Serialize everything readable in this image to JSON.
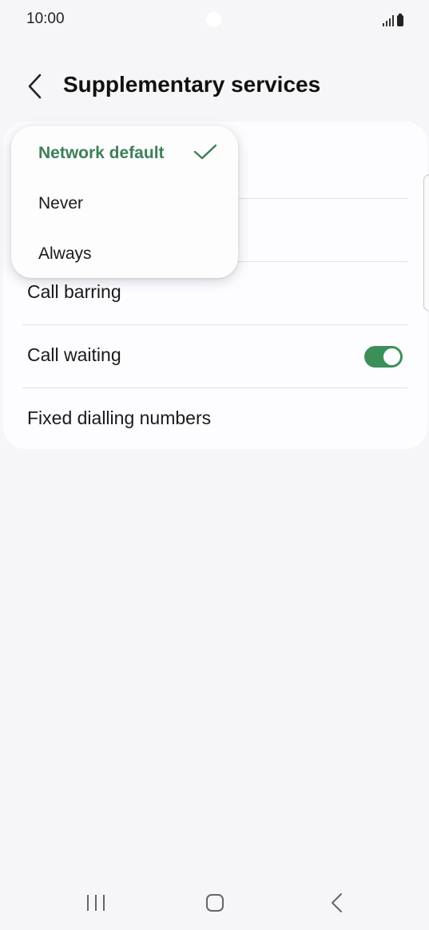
{
  "status_bar": {
    "time": "10:00"
  },
  "header": {
    "title": "Supplementary services"
  },
  "settings": {
    "items": [
      {
        "label": "Call barring"
      },
      {
        "label": "Call waiting",
        "toggle_on": true
      },
      {
        "label": "Fixed dialling numbers"
      }
    ]
  },
  "popup": {
    "options": [
      {
        "label": "Network default",
        "selected": true
      },
      {
        "label": "Never",
        "selected": false
      },
      {
        "label": "Always",
        "selected": false
      }
    ]
  },
  "colors": {
    "accent_green": "#3d8058",
    "toggle_green": "#3d8f5a",
    "background": "#f6f6f8"
  },
  "icons": {
    "back": "chevron-left-icon",
    "check": "check-icon",
    "recents": "recents-icon",
    "home": "home-icon",
    "nav_back": "nav-back-icon"
  }
}
